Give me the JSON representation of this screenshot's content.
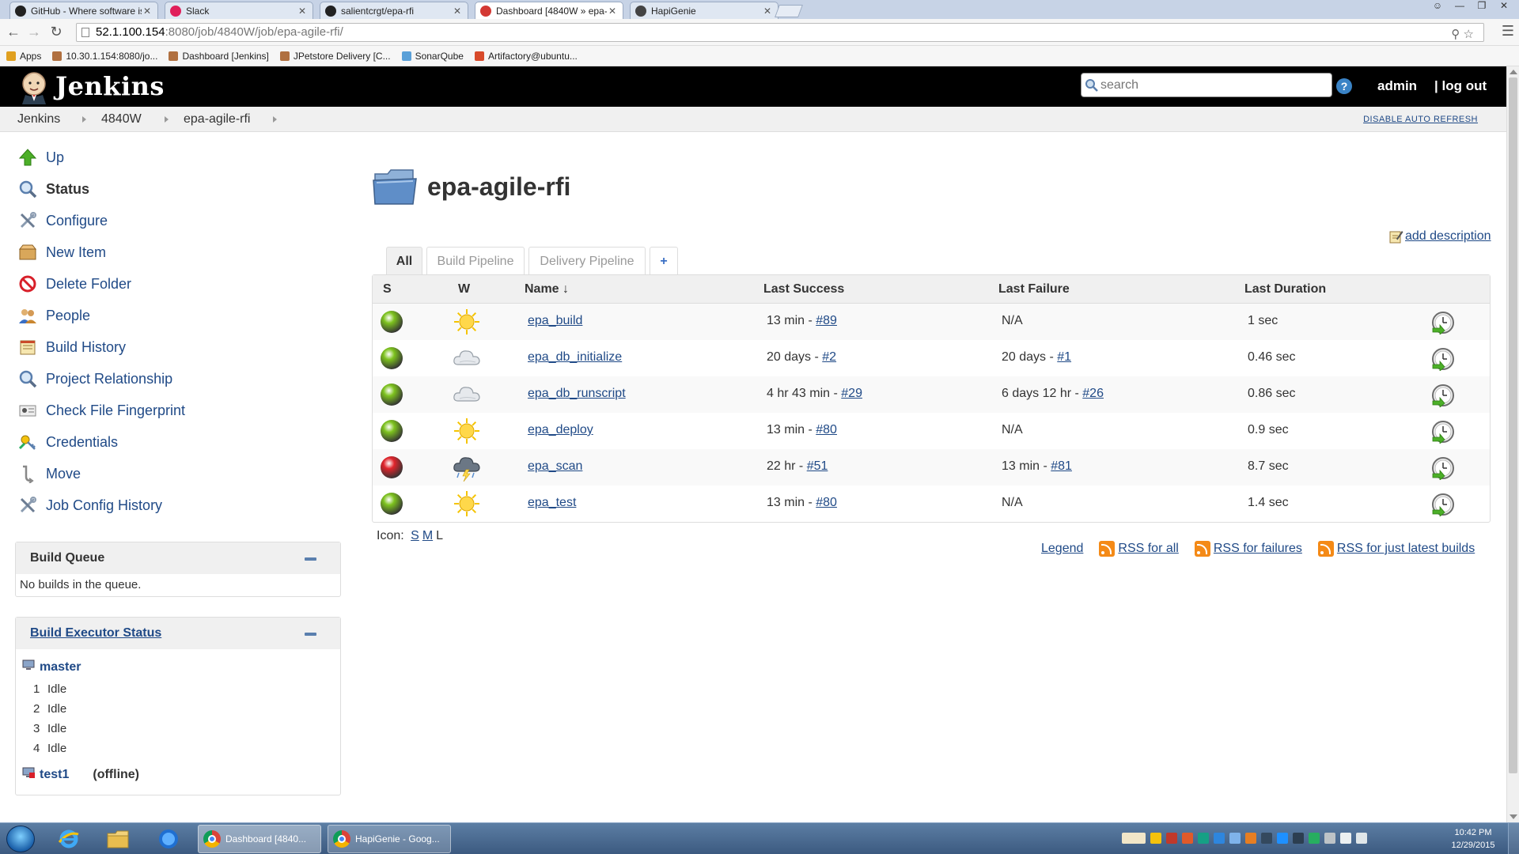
{
  "browser": {
    "tabs": [
      {
        "title": "GitHub - Where software is",
        "icon": "github-icon",
        "color": "#222222"
      },
      {
        "title": "Slack",
        "icon": "slack-icon",
        "color": "#e01e5a"
      },
      {
        "title": "salientcrgt/epa-rfi",
        "icon": "github-icon",
        "color": "#222222"
      },
      {
        "title": "Dashboard [4840W » epa-",
        "icon": "jenkins-icon",
        "color": "#d33833"
      },
      {
        "title": "HapiGenie",
        "icon": "hapigenie-icon",
        "color": "#444444"
      }
    ],
    "active_tab": 3,
    "url_host": "52.1.100.154",
    "url_path": ":8080/job/4840W/job/epa-agile-rfi/",
    "bookmarks": [
      {
        "label": "Apps",
        "color": "#e0a020"
      },
      {
        "label": "10.30.1.154:8080/jo...",
        "color": "#b07040"
      },
      {
        "label": "Dashboard [Jenkins]",
        "color": "#b07040"
      },
      {
        "label": "JPetstore Delivery [C...",
        "color": "#b07040"
      },
      {
        "label": "SonarQube",
        "color": "#5aa0d8"
      },
      {
        "label": "Artifactory@ubuntu...",
        "color": "#d84a2a"
      }
    ]
  },
  "header": {
    "title": "Jenkins",
    "search_placeholder": "search",
    "help_label": "?",
    "user": "admin",
    "logout": "| log out"
  },
  "breadcrumbs": [
    "Jenkins",
    "4840W",
    "epa-agile-rfi"
  ],
  "auto_refresh": "DISABLE AUTO REFRESH",
  "sidebar": {
    "tasks": [
      {
        "label": "Up",
        "icon": "up-arrow-icon"
      },
      {
        "label": "Status",
        "icon": "magnifier-icon"
      },
      {
        "label": "Configure",
        "icon": "wrench-screwdriver-icon"
      },
      {
        "label": "New Item",
        "icon": "new-package-icon"
      },
      {
        "label": "Delete Folder",
        "icon": "no-entry-icon"
      },
      {
        "label": "People",
        "icon": "people-icon"
      },
      {
        "label": "Build History",
        "icon": "notepad-icon"
      },
      {
        "label": "Project Relationship",
        "icon": "magnifier-icon"
      },
      {
        "label": "Check File Fingerprint",
        "icon": "fingerprint-icon"
      },
      {
        "label": "Credentials",
        "icon": "credentials-icon"
      },
      {
        "label": "Move",
        "icon": "move-icon"
      },
      {
        "label": "Job Config History",
        "icon": "wrench-screwdriver-icon"
      }
    ],
    "build_queue": {
      "title": "Build Queue",
      "empty": "No builds in the queue."
    },
    "executors": {
      "title": "Build Executor Status",
      "nodes": [
        {
          "name": "master",
          "status": "",
          "slots": [
            {
              "num": "1",
              "state": "Idle"
            },
            {
              "num": "2",
              "state": "Idle"
            },
            {
              "num": "3",
              "state": "Idle"
            },
            {
              "num": "4",
              "state": "Idle"
            }
          ]
        },
        {
          "name": "test1",
          "status": "(offline)",
          "slots": []
        }
      ]
    }
  },
  "main": {
    "title": "epa-agile-rfi",
    "add_description": "add description",
    "views": [
      "All",
      "Build Pipeline",
      "Delivery Pipeline",
      "+"
    ],
    "columns": {
      "s": "S",
      "w": "W",
      "name": "Name",
      "sort": "↓",
      "last_success": "Last Success",
      "last_failure": "Last Failure",
      "last_duration": "Last Duration"
    },
    "jobs": [
      {
        "name": "epa_build",
        "status": "success",
        "weather": "sunny",
        "success_time": "13 min - ",
        "success_build": "#89",
        "failure_time": "N/A",
        "failure_build": "",
        "duration": "1 sec"
      },
      {
        "name": "epa_db_initialize",
        "status": "success",
        "weather": "cloudy",
        "success_time": "20 days - ",
        "success_build": "#2",
        "failure_time": "20 days - ",
        "failure_build": "#1",
        "duration": "0.46 sec"
      },
      {
        "name": "epa_db_runscript",
        "status": "success",
        "weather": "cloudy",
        "success_time": "4 hr 43 min - ",
        "success_build": "#29",
        "failure_time": "6 days 12 hr - ",
        "failure_build": "#26",
        "duration": "0.86 sec"
      },
      {
        "name": "epa_deploy",
        "status": "success",
        "weather": "sunny",
        "success_time": "13 min - ",
        "success_build": "#80",
        "failure_time": "N/A",
        "failure_build": "",
        "duration": "0.9 sec"
      },
      {
        "name": "epa_scan",
        "status": "failed",
        "weather": "stormy",
        "success_time": "22 hr - ",
        "success_build": "#51",
        "failure_time": "13 min - ",
        "failure_build": "#81",
        "duration": "8.7 sec"
      },
      {
        "name": "epa_test",
        "status": "success",
        "weather": "sunny",
        "success_time": "13 min - ",
        "success_build": "#80",
        "failure_time": "N/A",
        "failure_build": "",
        "duration": "1.4 sec"
      }
    ],
    "icon_size": {
      "label": "Icon:",
      "small": "S",
      "medium": "M",
      "large": "L"
    },
    "footer_links": {
      "legend": "Legend",
      "rss_all": "RSS for all",
      "rss_failures": "RSS for failures",
      "rss_latest": "RSS for just latest builds"
    }
  },
  "taskbar": {
    "tasks": [
      {
        "label": "Dashboard [4840...",
        "active": true
      },
      {
        "label": "HapiGenie - Goog...",
        "active": false
      }
    ],
    "time": "10:42 PM",
    "date": "12/29/2015"
  },
  "colors": {
    "success_ball": "#7dc21e",
    "failed_ball": "#e0242b",
    "link": "#204a87",
    "header_bg": "#000000"
  }
}
